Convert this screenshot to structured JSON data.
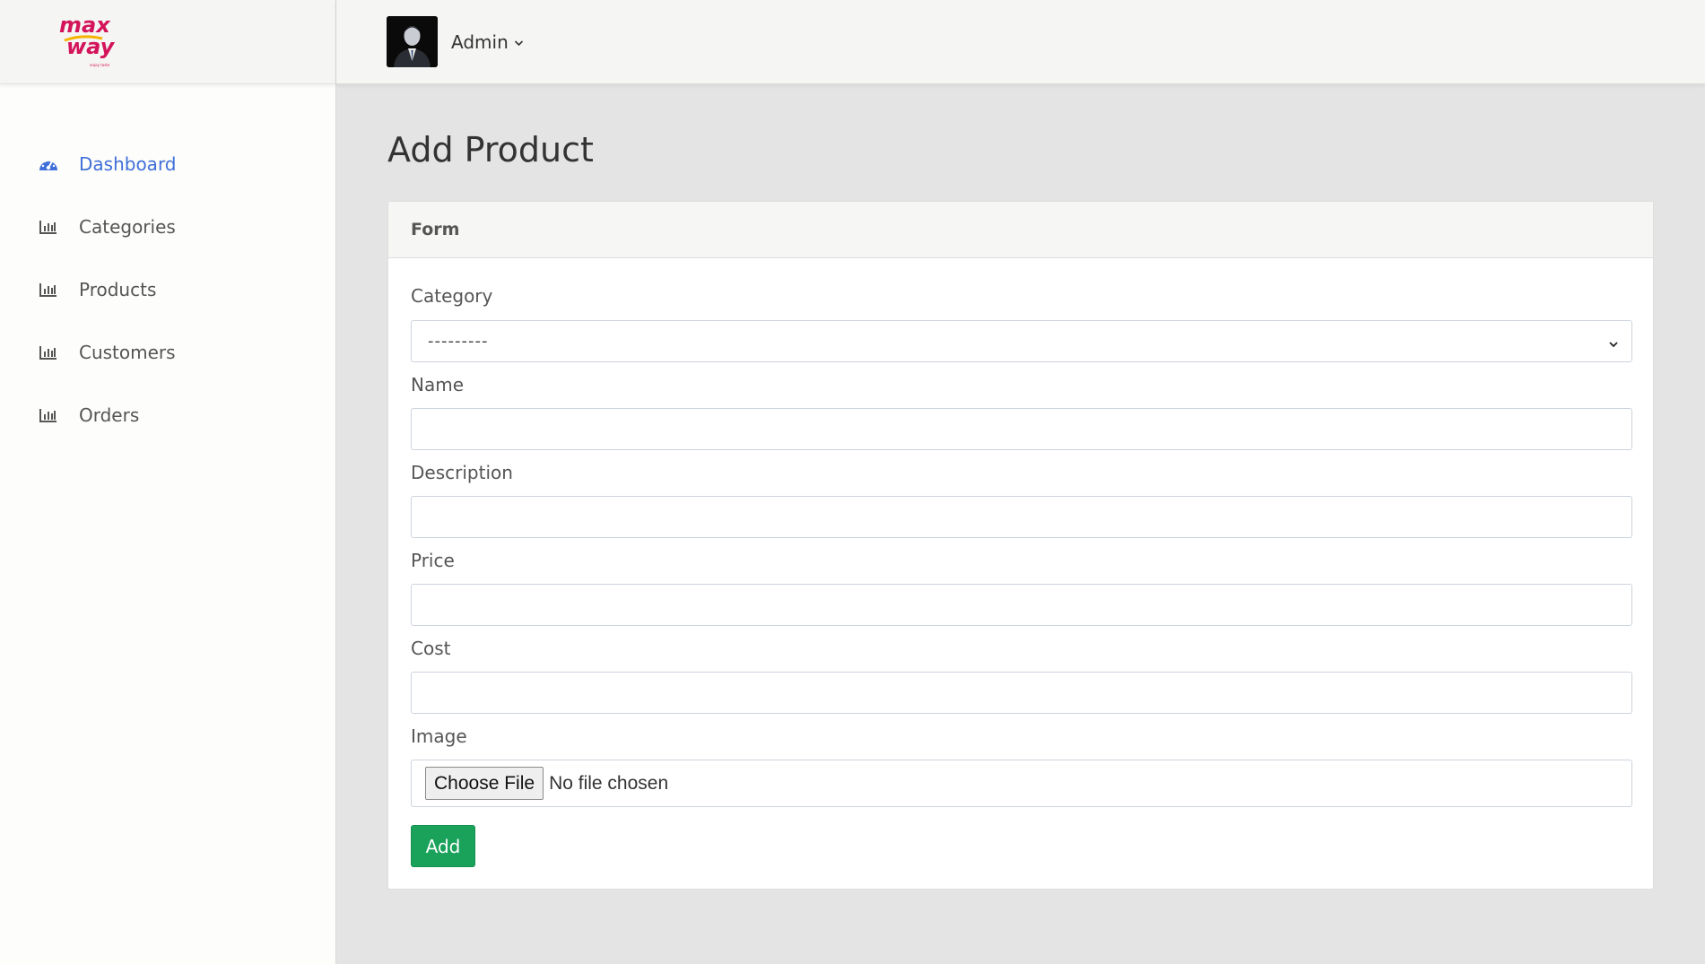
{
  "brand": {
    "logo_text_line1": "max",
    "logo_text_line2": "way",
    "logo_tagline": "enjoy taste"
  },
  "colors": {
    "accent": "#3f6fd8",
    "success": "#1aa15a",
    "logo": "#d4145a"
  },
  "sidebar": {
    "items": [
      {
        "label": "Dashboard",
        "icon": "tachometer-icon",
        "active": true
      },
      {
        "label": "Categories",
        "icon": "bar-chart-icon"
      },
      {
        "label": "Products",
        "icon": "bar-chart-icon"
      },
      {
        "label": "Customers",
        "icon": "bar-chart-icon"
      },
      {
        "label": "Orders",
        "icon": "bar-chart-icon"
      }
    ]
  },
  "topbar": {
    "user_label": "Admin",
    "dropdown_icon": "chevron-down-icon",
    "avatar_icon": "user-avatar"
  },
  "page": {
    "title": "Add Product"
  },
  "form": {
    "header": "Form",
    "category": {
      "label": "Category",
      "selected": "---------"
    },
    "name": {
      "label": "Name",
      "value": ""
    },
    "description": {
      "label": "Description",
      "value": ""
    },
    "price": {
      "label": "Price",
      "value": ""
    },
    "cost": {
      "label": "Cost",
      "value": ""
    },
    "image": {
      "label": "Image",
      "button": "Choose File",
      "status": "No file chosen"
    },
    "submit_label": "Add"
  }
}
